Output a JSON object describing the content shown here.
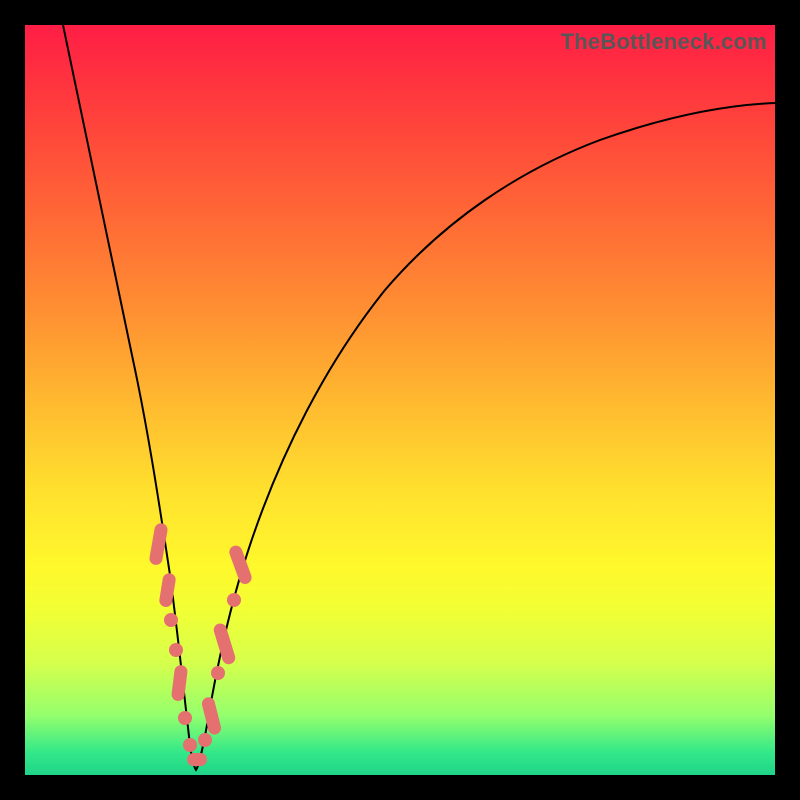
{
  "watermark": "TheBottleneck.com",
  "colors": {
    "background_frame": "#000000",
    "marker": "#e4706f",
    "curve": "#000000",
    "gradient_top": "#ff1e46",
    "gradient_bottom": "#1fd488"
  },
  "chart_data": {
    "type": "line",
    "title": "",
    "xlabel": "",
    "ylabel": "",
    "xlim": [
      0,
      100
    ],
    "ylim": [
      0,
      100
    ],
    "grid": false,
    "legend": false,
    "note": "V-shaped bottleneck curve; minimum near x≈22. y expressed as percent of plot height from bottom (0=bottom, 100=top). Values estimated from pixel positions; no axes/tick labels are rendered in the image.",
    "series": [
      {
        "name": "bottleneck-curve",
        "x": [
          5,
          8,
          11,
          14,
          16,
          18,
          19,
          20,
          21,
          22,
          23,
          24,
          25,
          26,
          28,
          31,
          35,
          40,
          46,
          53,
          61,
          70,
          80,
          90,
          100
        ],
        "values": [
          100,
          86,
          72,
          57,
          44,
          31,
          24,
          17,
          10,
          2,
          3,
          7,
          12,
          17,
          25,
          35,
          45,
          54,
          62,
          69,
          75,
          80,
          83,
          86,
          88
        ]
      }
    ],
    "markers": {
      "description": "Salmon capsule/dot clusters overlaid on the curve near the trough region",
      "points_xy_pct_from_bottom": [
        [
          18.0,
          31.0
        ],
        [
          18.7,
          27.0
        ],
        [
          19.3,
          22.0
        ],
        [
          20.0,
          16.0
        ],
        [
          20.7,
          10.0
        ],
        [
          21.5,
          4.0
        ],
        [
          22.3,
          1.0
        ],
        [
          23.3,
          2.0
        ],
        [
          24.0,
          6.0
        ],
        [
          24.7,
          10.0
        ],
        [
          25.7,
          16.0
        ],
        [
          26.7,
          21.0
        ],
        [
          27.7,
          26.0
        ],
        [
          28.7,
          30.0
        ]
      ]
    }
  }
}
